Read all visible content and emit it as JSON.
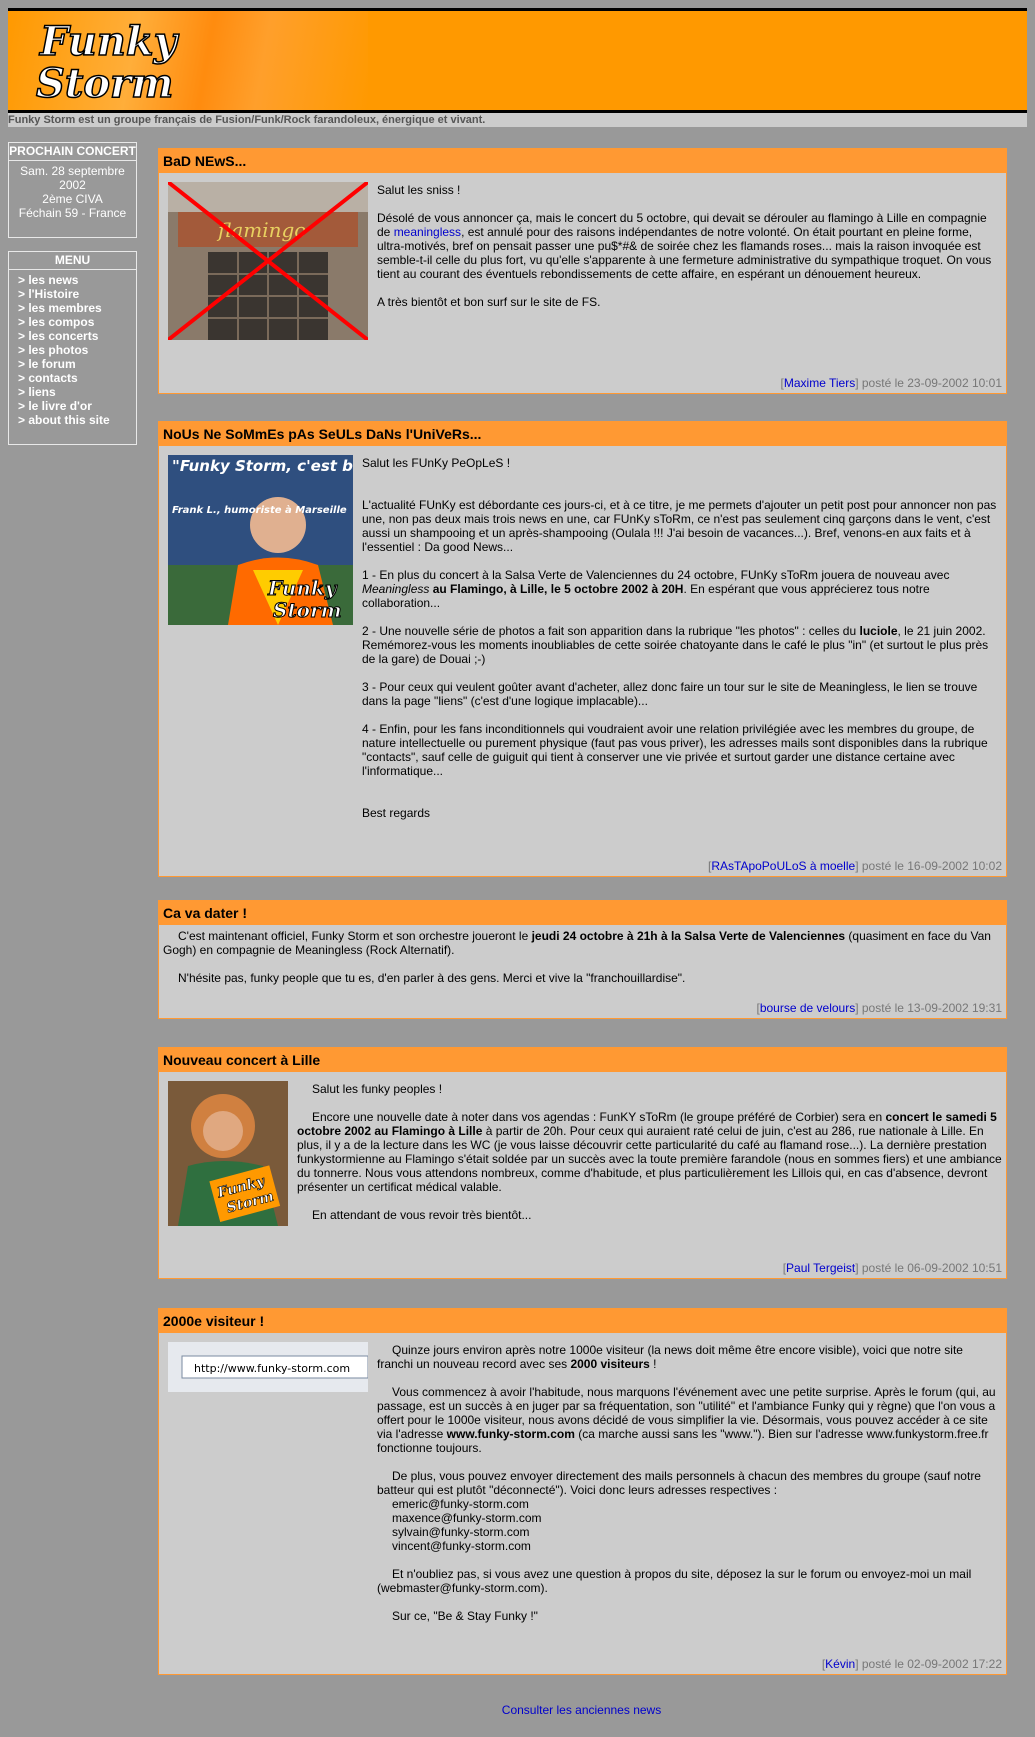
{
  "header": {
    "logo_line1": "Funky",
    "logo_line2": "Storm",
    "tagline": "Funky Storm est un groupe français de Fusion/Funk/Rock farandoleux, énergique et vivant."
  },
  "sidebar": {
    "concert_title": "PROCHAIN CONCERT",
    "concert_lines": [
      "Sam. 28 septembre",
      "2002",
      "2ème CIVA",
      "Féchain 59 - France"
    ],
    "menu_title": "MENU",
    "menu_items": [
      "> les news",
      "> l'Histoire",
      "> les membres",
      "> les compos",
      "> les concerts",
      "> les photos",
      "> le forum",
      "> contacts",
      "> liens",
      "> le livre d'or",
      "> about this site"
    ]
  },
  "news": [
    {
      "title": "BaD NEwS...",
      "p1": "Salut les sniss !",
      "p2_before": "Désolé de vous annoncer ça, mais le concert du 5 octobre, qui devait se dérouler au flamingo à Lille en compagnie de ",
      "p2_link": "meaningless",
      "p2_after": ", est annulé pour des raisons indépendantes de notre volonté. On était pourtant en pleine forme, ultra-motivés, bref on pensait passer une pu$*#& de soirée chez les flamands roses... mais la raison invoquée est semble-t-il celle du plus fort, vu qu'elle s'apparente à une fermeture administrative du sympathique troquet. On vous tient au courant des éventuels rebondissements de cette affaire, en espérant un dénouement heureux.",
      "p3": "A très bientôt et bon surf sur le site de FS.",
      "author": "Maxime Tiers",
      "posted": " posté le 23-09-2002 10:01",
      "img_text": "flamingo"
    },
    {
      "title": "NoUs Ne SoMmEs pAs SeULs DaNs l'UniVeRs...",
      "img_quote": "\"Funky Storm, c'est bien !\"",
      "img_caption": "Frank L., humoriste à Marseille",
      "img_logo1": "Funky",
      "img_logo2": "Storm",
      "p1": "Salut les FUnKy PeOpLeS !",
      "p2": "L'actualité FUnKy est débordante ces jours-ci, et à ce titre, je me permets d'ajouter un petit post pour annoncer non pas une, non pas deux mais trois news en une, car FUnKy sToRm, ce n'est pas seulement cinq garçons dans le vent, c'est aussi un shampooing et un après-shampooing (Oulala !!! J'ai besoin de vacances...). Bref, venons-en aux faits et à l'essentiel : Da good News...",
      "p3_a": "1 - En plus du concert à la Salsa Verte de Valenciennes du 24 octobre, FUnKy sToRm jouera de nouveau avec ",
      "p3_em": "Meaningless",
      "p3_b": " au Flamingo, à Lille, le 5 octobre 2002 à 20H",
      "p3_c": ". En espérant que vous apprécierez tous notre collaboration...",
      "p4_a": "2 - Une nouvelle série de photos a fait son apparition dans la rubrique \"les photos\" : celles du ",
      "p4_b": "luciole",
      "p4_c": ", le 21 juin 2002. Remémorez-vous les moments inoubliables de cette soirée chatoyante dans le café le plus \"in\" (et surtout le plus près de la gare) de Douai ;-)",
      "p5": "3 - Pour ceux qui veulent goûter avant d'acheter, allez donc faire un tour sur le site de Meaningless, le lien se trouve dans la page \"liens\" (c'est d'une logique implacable)...",
      "p6": "4 - Enfin, pour les fans inconditionnels qui voudraient avoir une relation privilégiée avec les membres du groupe, de nature intellectuelle ou purement physique (faut pas vous priver), les adresses mails sont disponibles dans la rubrique \"contacts\", sauf celle de guiguit qui tient à conserver une vie privée et surtout garder une distance certaine avec l'informatique...",
      "p7": "Best regards",
      "author": "RAsTApoPoULoS à moelle",
      "posted": " posté le 16-09-2002 10:02"
    },
    {
      "title": "Ca va dater !",
      "p1_a": "C'est maintenant officiel, Funky Storm et son orchestre joueront le ",
      "p1_b": "jeudi 24 octobre à 21h à la Salsa Verte de Valenciennes",
      "p1_c": " (quasiment en face du Van Gogh) en compagnie de Meaningless (Rock Alternatif).",
      "p2": "N'hésite pas, funky people que tu es, d'en parler à des gens. Merci et vive la \"franchouillardise\".",
      "author": "bourse de velours",
      "posted": " posté le 13-09-2002 19:31"
    },
    {
      "title": "Nouveau concert à Lille",
      "img_logo1": "Funky",
      "img_logo2": "Storm",
      "p1": "Salut les funky peoples !",
      "p2_a": "Encore une nouvelle date à noter dans vos agendas : FunKY sToRm (le groupe préféré de Corbier) sera en ",
      "p2_b": "concert le samedi 5 octobre 2002 au Flamingo à Lille",
      "p2_c": " à partir de 20h. Pour ceux qui auraient raté celui de juin, c'est au 286, rue nationale à Lille. En plus, il y a de la lecture dans les WC (je vous laisse découvrir cette particularité du café au flamand rose...). La dernière prestation funkystormienne au Flamingo s'était soldée par un succès avec la toute première farandole (nous en sommes fiers) et une ambiance du tonnerre. Nous vous attendons nombreux, comme d'habitude, et plus particulièrement les Lillois qui, en cas d'absence, devront présenter un certificat médical valable.",
      "p3": "En attendant de vous revoir très bientôt...",
      "author": "Paul Tergeist",
      "posted": " posté le 06-09-2002 10:51"
    },
    {
      "title": "2000e visiteur !",
      "img_url": "http://www.funky-storm.com",
      "p1_a": "Quinze jours environ après notre 1000e visiteur (la news doit même être encore visible), voici que notre site franchi un nouveau record avec ses ",
      "p1_b": "2000 visiteurs",
      "p1_c": " !",
      "p2_a": "Vous commencez à avoir l'habitude, nous marquons l'événement avec une petite surprise. Après le forum (qui, au passage, est un succès à en juger par sa fréquentation, son \"utilité\" et l'ambiance Funky qui y règne) que l'on vous a offert pour le 1000e visiteur, nous avons décidé de vous simplifier la vie. Désormais, vous pouvez accéder à ce site via l'adresse ",
      "p2_b": "www.funky-storm.com",
      "p2_c": " (ca marche aussi sans les \"www.\"). Bien sur l'adresse www.funkystorm.free.fr fonctionne toujours.",
      "p3": "De plus, vous pouvez envoyer directement des mails personnels à chacun des membres du groupe (sauf notre batteur qui est plutôt \"déconnecté\"). Voici donc leurs adresses respectives :",
      "emails": [
        "emeric@funky-storm.com",
        "maxence@funky-storm.com",
        "sylvain@funky-storm.com",
        "vincent@funky-storm.com"
      ],
      "p4": "Et n'oubliez pas, si vous avez une question à propos du site, déposez la sur le forum ou envoyez-moi un mail (webmaster@funky-storm.com).",
      "p5": "Sur ce, \"Be & Stay Funky !\"",
      "author": "Kévin",
      "posted": " posté le 02-09-2002 17:22"
    }
  ],
  "footer": {
    "old_news_link": "Consulter les anciennes news"
  },
  "colors": {
    "orange": "#ff9900",
    "title_bar": "#ff9933",
    "page_bg": "#999999",
    "box_bg": "#cccccc",
    "link": "#0000cc"
  }
}
